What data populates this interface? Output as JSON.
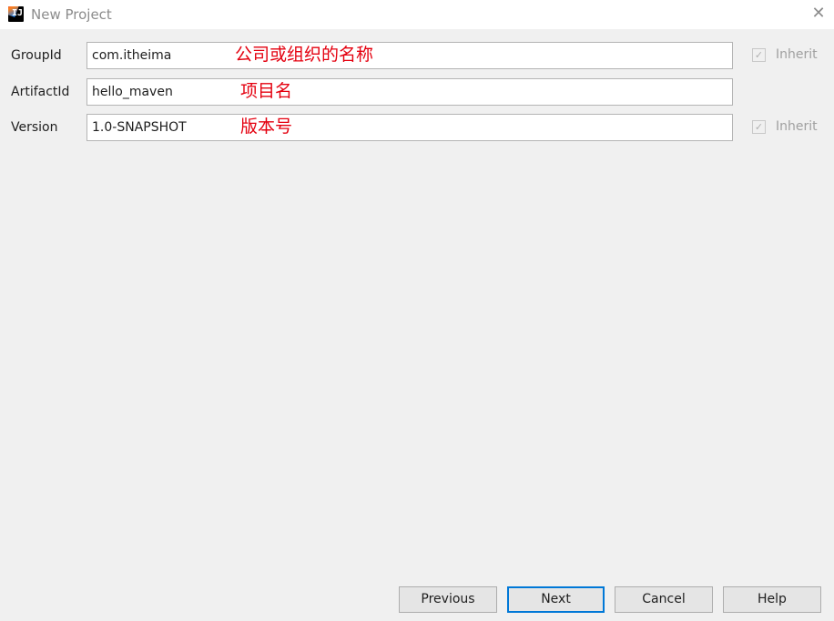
{
  "window": {
    "title": "New Project",
    "close_glyph": "✕",
    "app_icon_glyph": "IJ"
  },
  "form": {
    "group_id": {
      "label": "GroupId",
      "value": "com.itheima",
      "annotation": "公司或组织的名称",
      "inherit_label": "Inherit",
      "inherit_checked": true
    },
    "artifact_id": {
      "label": "ArtifactId",
      "value": "hello_maven",
      "annotation": "项目名"
    },
    "version": {
      "label": "Version",
      "value": "1.0-SNAPSHOT",
      "annotation": "版本号",
      "inherit_label": "Inherit",
      "inherit_checked": true
    }
  },
  "buttons": {
    "previous": "Previous",
    "next": "Next",
    "cancel": "Cancel",
    "help": "Help"
  },
  "colors": {
    "annotation": "#e4000f",
    "default_button_border": "#0078d7",
    "background": "#f0f0f0"
  },
  "icons": {
    "app": "intellij-idea-icon",
    "close": "close-icon",
    "checkbox": "checkmark-icon"
  }
}
